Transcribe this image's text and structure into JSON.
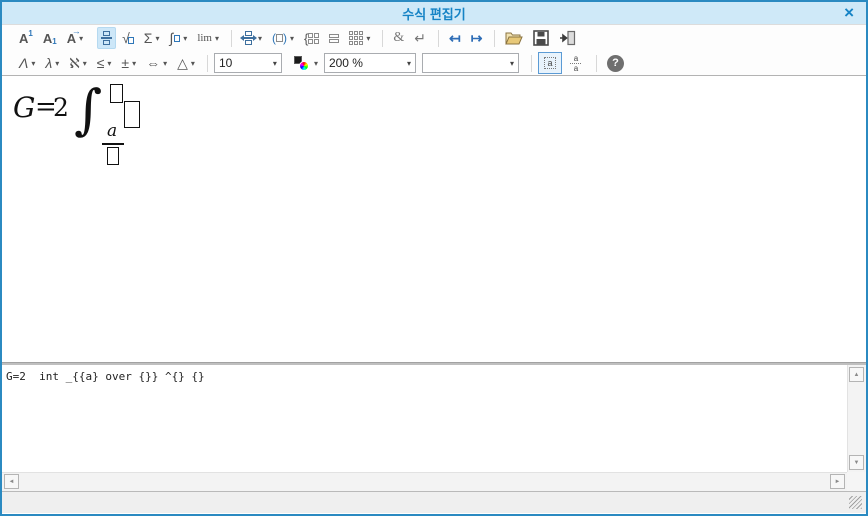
{
  "titlebar": {
    "title": "수식 편집기",
    "close_glyph": "×"
  },
  "glyphs": {
    "caret": "▾",
    "sup_base": "A",
    "sup_mark": "1",
    "sub_base": "A",
    "sub_mark": "1",
    "accent_base": "A",
    "accent_arrow": "→",
    "radical": "√",
    "sum": "Σ",
    "integral": "∫",
    "limit": "lim",
    "paren_open": "(",
    "paren_close": ")",
    "brace": "{",
    "ampersand": "&",
    "newline": "↵",
    "prev_item": "↤",
    "next_item": "↦",
    "greek_upper": "Λ",
    "greek_lower": "λ",
    "other_symbol": "ℵ",
    "relation": "≤",
    "operator": "±",
    "arrow": "⇔",
    "misc": "△",
    "slot_a": "a",
    "script_a_top": "a",
    "script_a_bottom": "a",
    "help": "?",
    "scroll_up": "▲",
    "scroll_down": "▼",
    "scroll_left": "◄",
    "scroll_right": "►"
  },
  "controls": {
    "font_size_value": "10",
    "zoom_value": "200 %",
    "preset_value": ""
  },
  "equation": {
    "lhs": "G",
    "equals": "=",
    "coefficient": "2",
    "integral": "∫",
    "lower_numerator": "a"
  },
  "script": {
    "text": "G=2  int _{{a} over {}} ^{} {}"
  },
  "colors": {
    "accent": "#1583c5",
    "titlebar_bg": "#cfe9f8",
    "icon_blue": "#2e76b8",
    "selected_bg": "#cde7f8",
    "border": "#2b8ac1"
  }
}
